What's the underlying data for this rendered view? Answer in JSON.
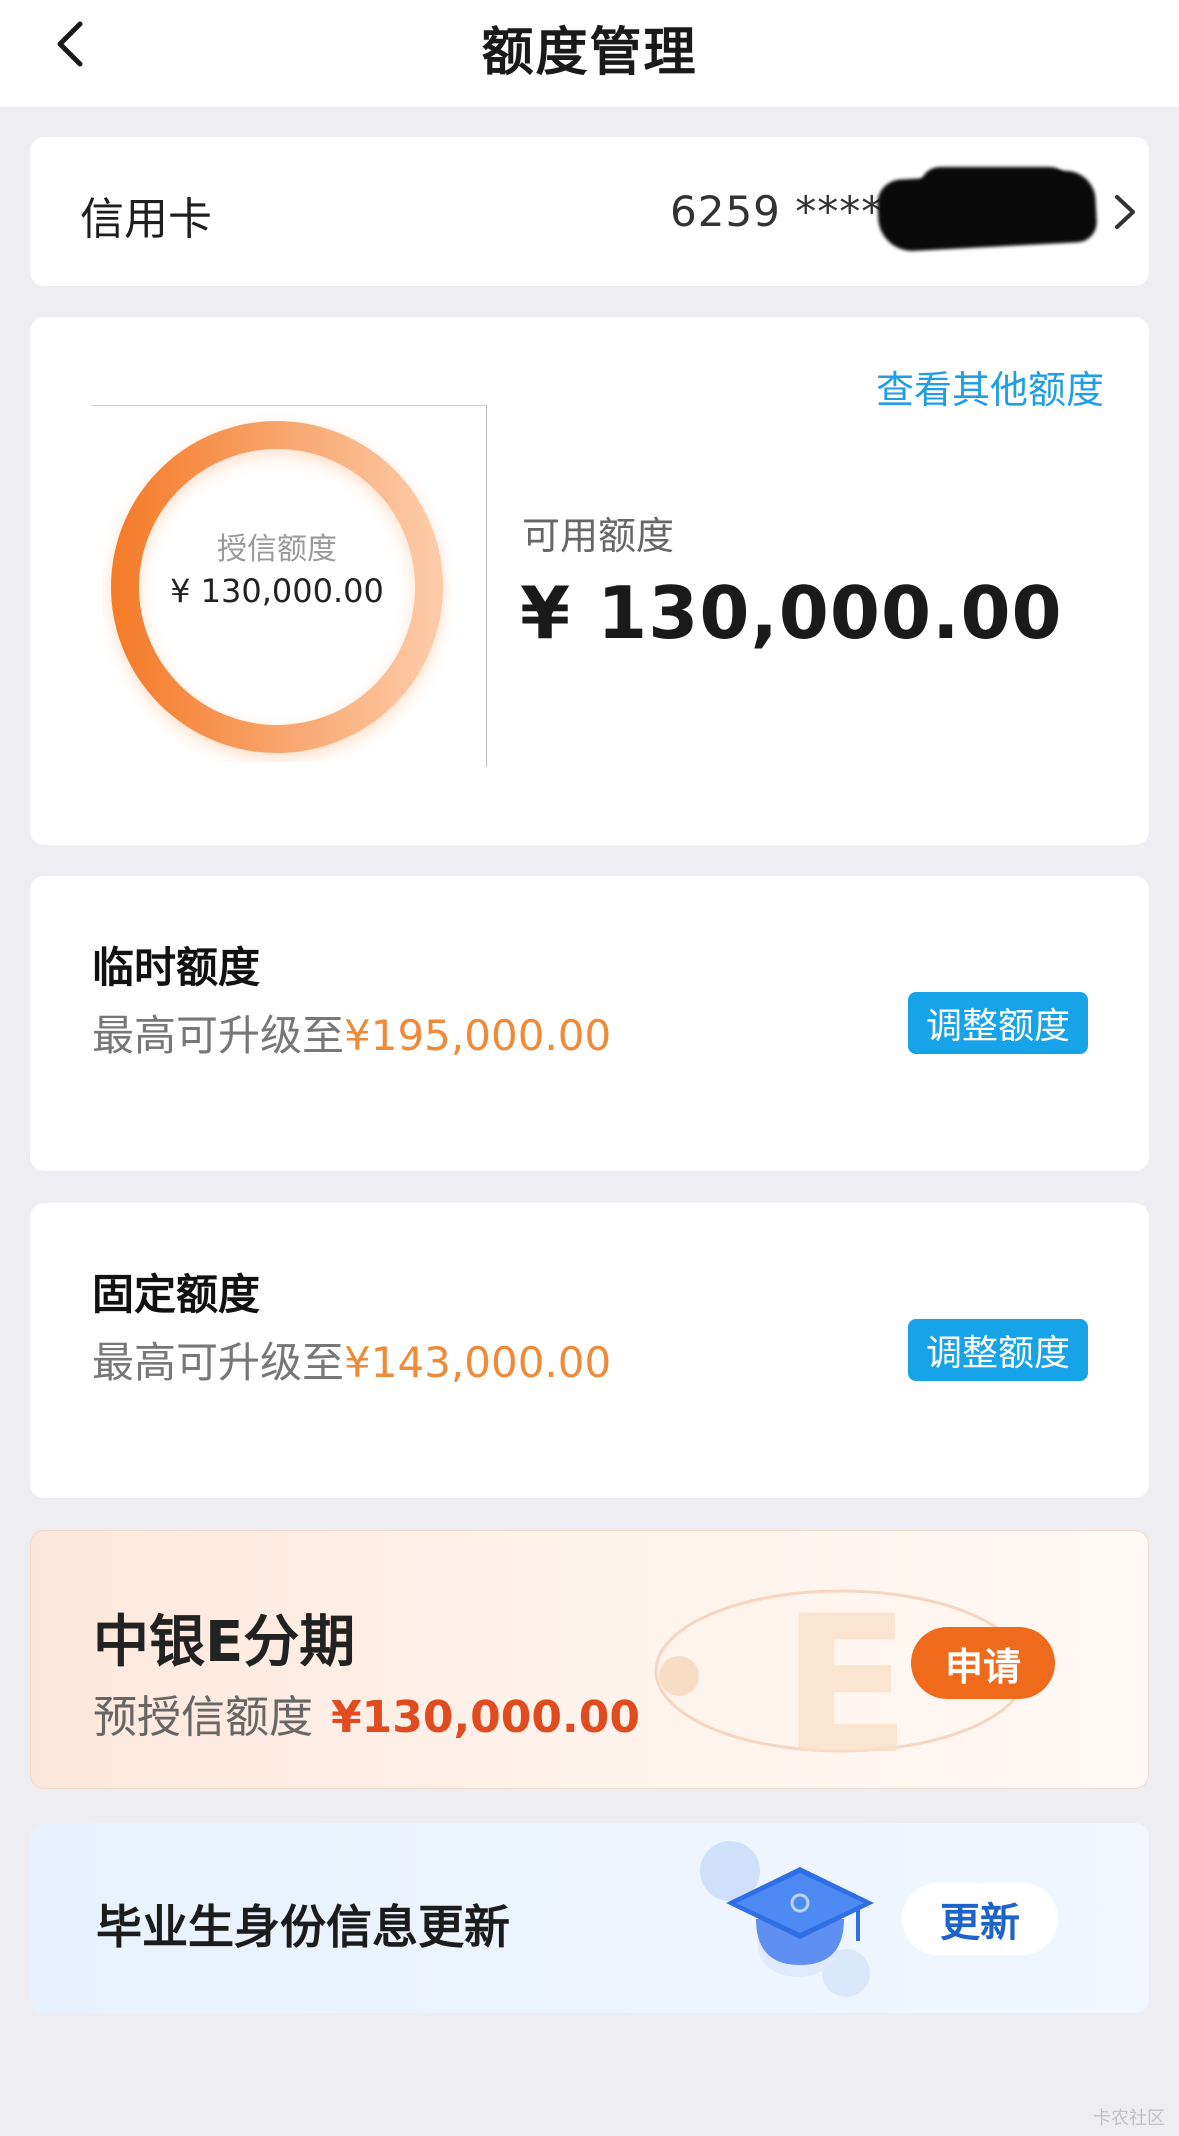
{
  "header": {
    "title": "额度管理"
  },
  "card_row": {
    "label": "信用卡",
    "card_number": "6259 *****"
  },
  "quota": {
    "other_link": "查看其他额度",
    "ring_label": "授信额度",
    "ring_value": "¥ 130,000.00",
    "available_label": "可用额度",
    "available_value": "¥ 130,000.00",
    "ring_colors": {
      "start": "#f47d2c",
      "end": "#fccaa7"
    }
  },
  "temp_limit": {
    "title": "临时额度",
    "sub_prefix": "最高可升级至",
    "sub_amount": "¥195,000.00",
    "button": "调整额度"
  },
  "fixed_limit": {
    "title": "固定额度",
    "sub_prefix": "最高可升级至",
    "sub_amount": "¥143,000.00",
    "button": "调整额度"
  },
  "e_installment": {
    "title": "中银E分期",
    "sub_prefix": "预授信额度",
    "sub_amount": "¥130,000.00",
    "button": "申请"
  },
  "graduate": {
    "title": "毕业生身份信息更新",
    "button": "更新"
  },
  "watermark": "卡农社区",
  "colors": {
    "accent_blue": "#17a3e8",
    "accent_orange": "#ef8a38",
    "apply_orange": "#f06a1c",
    "update_blue": "#1e63c8"
  }
}
